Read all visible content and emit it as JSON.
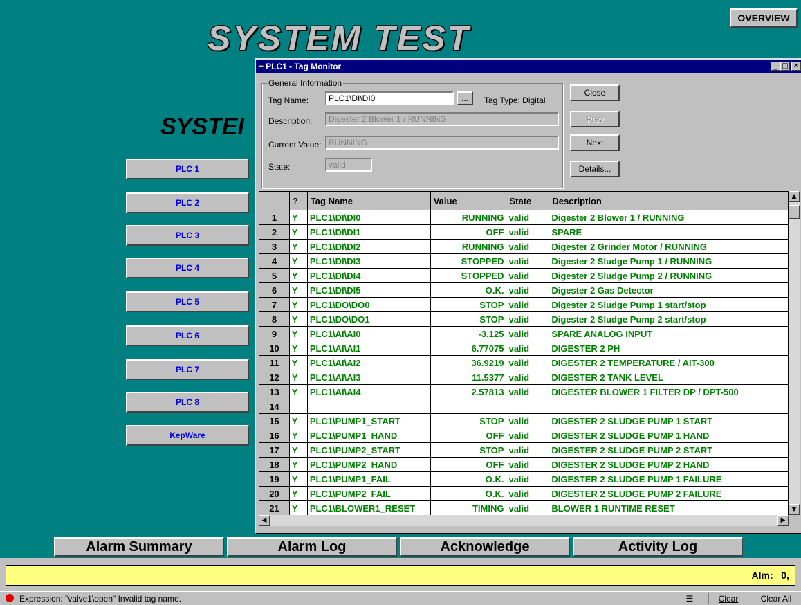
{
  "overview_label": "OVERVIEW",
  "main_title": "SYSTEM TEST",
  "sub_title": "SYSTEI",
  "plc_buttons": [
    "PLC 1",
    "PLC 2",
    "PLC 3",
    "PLC 4",
    "PLC 5",
    "PLC 6",
    "PLC 7",
    "PLC 8",
    "KepWare"
  ],
  "window": {
    "title": "PLC1 - Tag Monitor",
    "group_label": "General Information",
    "tag_name_label": "Tag Name:",
    "tag_name_value": "PLC1\\DI\\DI0",
    "browse_label": "...",
    "tag_type": "Tag Type: Digital",
    "description_label": "Description:",
    "description_value": "Digester 2 Blower 1 / RUNNING",
    "current_value_label": "Current Value:",
    "current_value": "RUNNING",
    "state_label": "State:",
    "state_value": "valid",
    "buttons": {
      "close": "Close",
      "prev": "Prev",
      "next": "Next",
      "details": "Details..."
    }
  },
  "grid": {
    "headers": {
      "q": "?",
      "tag": "Tag Name",
      "value": "Value",
      "state": "State",
      "desc": "Description"
    },
    "rows": [
      {
        "n": "1",
        "q": "Y",
        "tag": "PLC1\\DI\\DI0",
        "value": "RUNNING",
        "state": "valid",
        "desc": "Digester 2 Blower 1 / RUNNING"
      },
      {
        "n": "2",
        "q": "Y",
        "tag": "PLC1\\DI\\DI1",
        "value": "OFF",
        "state": "valid",
        "desc": "SPARE"
      },
      {
        "n": "3",
        "q": "Y",
        "tag": "PLC1\\DI\\DI2",
        "value": "RUNNING",
        "state": "valid",
        "desc": "Digester 2 Grinder Motor / RUNNING"
      },
      {
        "n": "4",
        "q": "Y",
        "tag": "PLC1\\DI\\DI3",
        "value": "STOPPED",
        "state": "valid",
        "desc": "Digester 2 Sludge Pump 1  / RUNNING"
      },
      {
        "n": "5",
        "q": "Y",
        "tag": "PLC1\\DI\\DI4",
        "value": "STOPPED",
        "state": "valid",
        "desc": "Digester 2 Sludge Pump 2 / RUNNING"
      },
      {
        "n": "6",
        "q": "Y",
        "tag": "PLC1\\DI\\DI5",
        "value": "O.K.",
        "state": "valid",
        "desc": "Digester 2 Gas Detector"
      },
      {
        "n": "7",
        "q": "Y",
        "tag": "PLC1\\DO\\DO0",
        "value": "STOP",
        "state": "valid",
        "desc": "Digester 2 Sludge Pump 1 start/stop"
      },
      {
        "n": "8",
        "q": "Y",
        "tag": "PLC1\\DO\\DO1",
        "value": "STOP",
        "state": "valid",
        "desc": "Digester 2 Sludge Pump 2 start/stop"
      },
      {
        "n": "9",
        "q": "Y",
        "tag": "PLC1\\AI\\AI0",
        "value": "-3.125",
        "state": "valid",
        "desc": "SPARE ANALOG INPUT"
      },
      {
        "n": "10",
        "q": "Y",
        "tag": "PLC1\\AI\\AI1",
        "value": "6.77075",
        "state": "valid",
        "desc": "DIGESTER 2 PH"
      },
      {
        "n": "11",
        "q": "Y",
        "tag": "PLC1\\AI\\AI2",
        "value": "36.9219",
        "state": "valid",
        "desc": "DIGESTER 2 TEMPERATURE / AIT-300"
      },
      {
        "n": "12",
        "q": "Y",
        "tag": "PLC1\\AI\\AI3",
        "value": "11.5377",
        "state": "valid",
        "desc": "DIGESTER 2 TANK LEVEL"
      },
      {
        "n": "13",
        "q": "Y",
        "tag": "PLC1\\AI\\AI4",
        "value": "2.57813",
        "state": "valid",
        "desc": "DIGESTER BLOWER 1 FILTER DP /  DPT-500"
      },
      {
        "n": "14",
        "q": "",
        "tag": "",
        "value": "",
        "state": "",
        "desc": ""
      },
      {
        "n": "15",
        "q": "Y",
        "tag": "PLC1\\PUMP1_START",
        "value": "STOP",
        "state": "valid",
        "desc": "DIGESTER 2 SLUDGE PUMP 1 START"
      },
      {
        "n": "16",
        "q": "Y",
        "tag": "PLC1\\PUMP1_HAND",
        "value": "OFF",
        "state": "valid",
        "desc": "DIGESTER 2 SLUDGE PUMP 1 HAND"
      },
      {
        "n": "17",
        "q": "Y",
        "tag": "PLC1\\PUMP2_START",
        "value": "STOP",
        "state": "valid",
        "desc": "DIGESTER 2 SLUDGE PUMP 2 START"
      },
      {
        "n": "18",
        "q": "Y",
        "tag": "PLC1\\PUMP2_HAND",
        "value": "OFF",
        "state": "valid",
        "desc": "DIGESTER 2 SLUDGE PUMP 2 HAND"
      },
      {
        "n": "19",
        "q": "Y",
        "tag": "PLC1\\PUMP1_FAIL",
        "value": "O.K.",
        "state": "valid",
        "desc": "DIGESTER 2 SLUDGE PUMP 1 FAILURE"
      },
      {
        "n": "20",
        "q": "Y",
        "tag": "PLC1\\PUMP2_FAIL",
        "value": "O.K.",
        "state": "valid",
        "desc": "DIGESTER 2 SLUDGE PUMP 2 FAILURE"
      },
      {
        "n": "21",
        "q": "Y",
        "tag": "PLC1\\BLOWER1_RESET",
        "value": "TIMING",
        "state": "valid",
        "desc": "BLOWER 1 RUNTIME RESET"
      }
    ]
  },
  "alarm_buttons": [
    "Alarm Summary",
    "Alarm Log",
    "Acknowledge",
    "Activity Log"
  ],
  "alarm_count": "Alm:   0,",
  "status": {
    "message": "Expression: \"valve1\\open\"  Invalid tag name.",
    "clear": "Clear",
    "clear_all": "Clear All"
  },
  "icons": {
    "close": "close-icon",
    "minimize": "minimize-icon",
    "maximize": "maximize-icon",
    "error": "error-icon"
  }
}
